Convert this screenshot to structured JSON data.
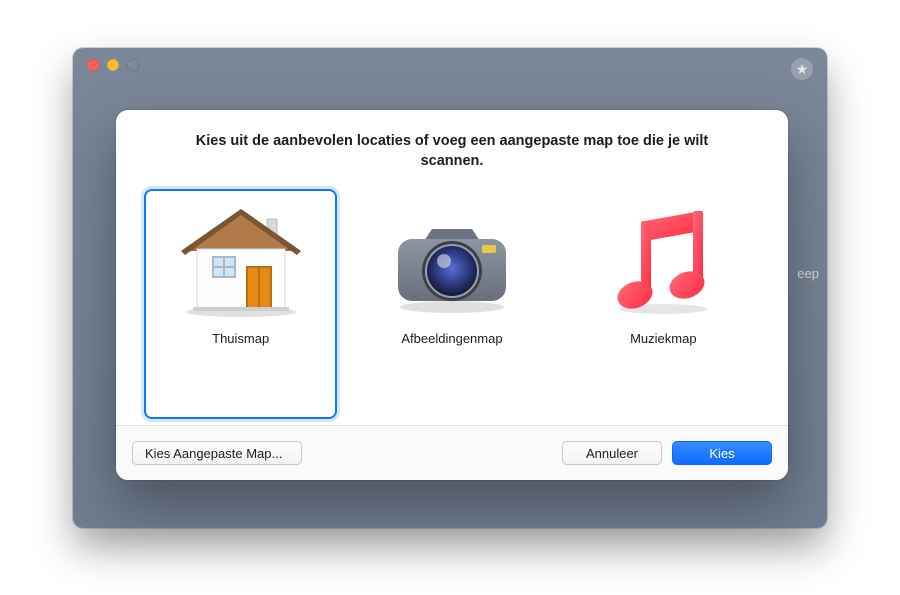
{
  "window": {
    "hidden_text": "eep"
  },
  "dialog": {
    "title": "Kies uit de aanbevolen locaties of voeg een aangepaste map toe die je wilt scannen.",
    "options": [
      {
        "label": "Thuismap",
        "selected": true
      },
      {
        "label": "Afbeeldingenmap",
        "selected": false
      },
      {
        "label": "Muziekmap",
        "selected": false
      }
    ],
    "buttons": {
      "custom": "Kies Aangepaste Map...",
      "cancel": "Annuleer",
      "choose": "Kies"
    }
  },
  "colors": {
    "accent": "#0a7aff",
    "primaryButton": "#0a6cff"
  }
}
